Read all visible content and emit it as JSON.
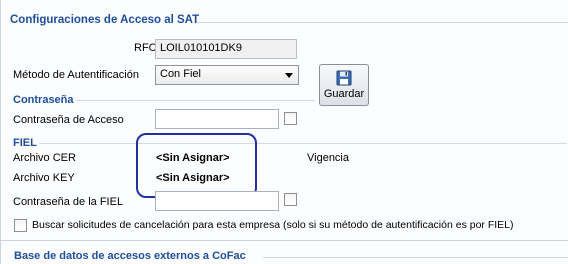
{
  "section_title": "Configuraciones de Acceso al SAT",
  "rfc": {
    "label": "RFC",
    "value": "LOIL010101DK9"
  },
  "auth": {
    "label": "Método de Autentificación",
    "selected": "Con Fiel"
  },
  "save_button": {
    "label": "Guardar",
    "icon": "floppy-disk-icon"
  },
  "contrasena_group": {
    "title": "Contraseña",
    "access_label": "Contraseña de Acceso",
    "access_value": ""
  },
  "fiel_group": {
    "title": "FIEL",
    "cer_label": "Archivo CER",
    "cer_value": "<Sin Asignar>",
    "key_label": "Archivo KEY",
    "key_value": "<Sin Asignar>",
    "vigencia_label": "Vigencia",
    "password_label": "Contraseña de la FIEL",
    "password_value": ""
  },
  "cancel_search": {
    "label": "Buscar solicitudes de cancelación para esta empresa (solo si su método de autentificación es por FIEL)",
    "checked": false
  },
  "external_db_title": "Base de datos de accesos externos a CoFac",
  "colors": {
    "section_blue": "#1f4e9a",
    "highlight_ring": "#23319e"
  }
}
